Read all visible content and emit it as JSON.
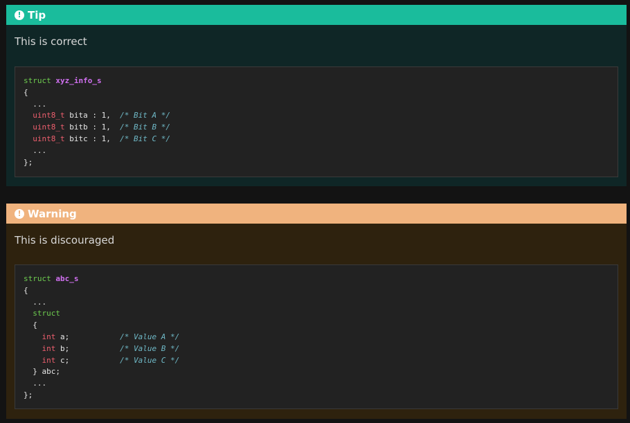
{
  "tip": {
    "title": "Tip",
    "icon": "exclamation-circle-icon",
    "color": "#1abc9c",
    "text": "This is correct",
    "code": {
      "kw_struct": "struct",
      "name": "xyz_info_s",
      "open": "{",
      "ellipsis": "...",
      "fields": [
        {
          "type": "uint8_t",
          "decl": " bita : 1,  ",
          "comment": "/* Bit A */"
        },
        {
          "type": "uint8_t",
          "decl": " bitb : 1,  ",
          "comment": "/* Bit B */"
        },
        {
          "type": "uint8_t",
          "decl": " bitc : 1,  ",
          "comment": "/* Bit C */"
        }
      ],
      "close": "};"
    }
  },
  "warning": {
    "title": "Warning",
    "icon": "exclamation-circle-icon",
    "color": "#f0b37e",
    "text": "This is discouraged",
    "code": {
      "kw_struct": "struct",
      "name": "abc_s",
      "open": "{",
      "ellipsis": "...",
      "inner_struct": "struct",
      "inner_open": "{",
      "fields": [
        {
          "type": "int",
          "decl": " a;           ",
          "comment": "/* Value A */"
        },
        {
          "type": "int",
          "decl": " b;           ",
          "comment": "/* Value B */"
        },
        {
          "type": "int",
          "decl": " c;           ",
          "comment": "/* Value C */"
        }
      ],
      "inner_close": "} abc;",
      "close": "};"
    }
  }
}
